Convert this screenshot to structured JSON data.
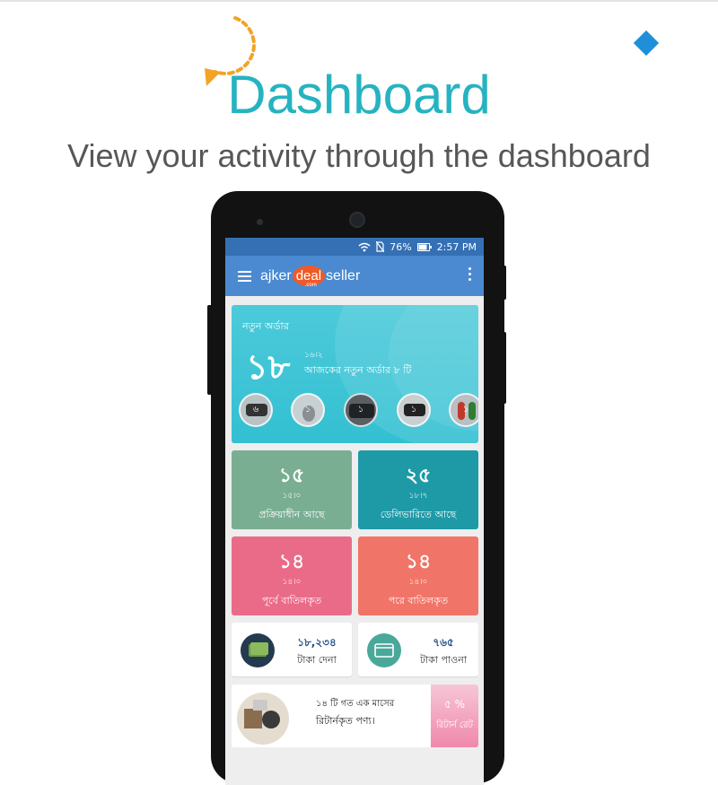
{
  "header": {
    "title": "Dashboard",
    "subtitle": "View your activity through the dashboard"
  },
  "status_bar": {
    "battery": "76%",
    "time": "2:57 PM"
  },
  "app_bar": {
    "logo_part1": "ajker",
    "logo_part2": "deal",
    "logo_part3": "seller",
    "logo_suffix": ".com"
  },
  "new_orders": {
    "label": "নতুন অর্ডার",
    "count": "১৮",
    "small": "১৬।২",
    "today_text": "আজকের নতুন অর্ডার ৮ টি",
    "thumbnails": [
      {
        "badge": "৬"
      },
      {
        "badge": "১"
      },
      {
        "badge": "১"
      },
      {
        "badge": "১"
      },
      {
        "badge": "১"
      }
    ]
  },
  "tiles": [
    {
      "value": "১৫",
      "small": "১৫।০",
      "label": "প্রক্রিয়াধীন আছে",
      "color": "#7aae93"
    },
    {
      "value": "২৫",
      "small": "১৮।৭",
      "label": "ডেলিভারিতে আছে",
      "color": "#1e9aa7"
    },
    {
      "value": "১৪",
      "small": "১৪।০",
      "label": "পূর্বে বাতিলকৃত",
      "color": "#ea6b88"
    },
    {
      "value": "১৪",
      "small": "১৪।০",
      "label": "পরে বাতিলকৃত",
      "color": "#f17468"
    }
  ],
  "wallet": {
    "payable": {
      "amount": "১৮,২৩৪",
      "label": "টাকা দেনা"
    },
    "receivable": {
      "amount": "৭৬৫",
      "label": "টাকা পাওনা"
    }
  },
  "returns": {
    "line1": "১৪ টি গত এক মাসের",
    "line2": "রিটার্নকৃত পণ্য।",
    "rate": "৫ %",
    "rate_label": "রিটার্ন রেট"
  },
  "colors": {
    "title": "#26b3c1",
    "status_bar": "#3570b5",
    "app_bar": "#4b8ad0",
    "hero": "#33c0d2",
    "logo_accent": "#f05a28",
    "refresh_icon": "#f3a326",
    "diamond_icon": "#1e8fd8"
  },
  "icons": [
    "refresh-icon",
    "diamond-icon",
    "wifi-icon",
    "no-sim-icon",
    "battery-icon",
    "menu-icon",
    "more-vert-icon",
    "wallet-icon",
    "card-icon"
  ]
}
